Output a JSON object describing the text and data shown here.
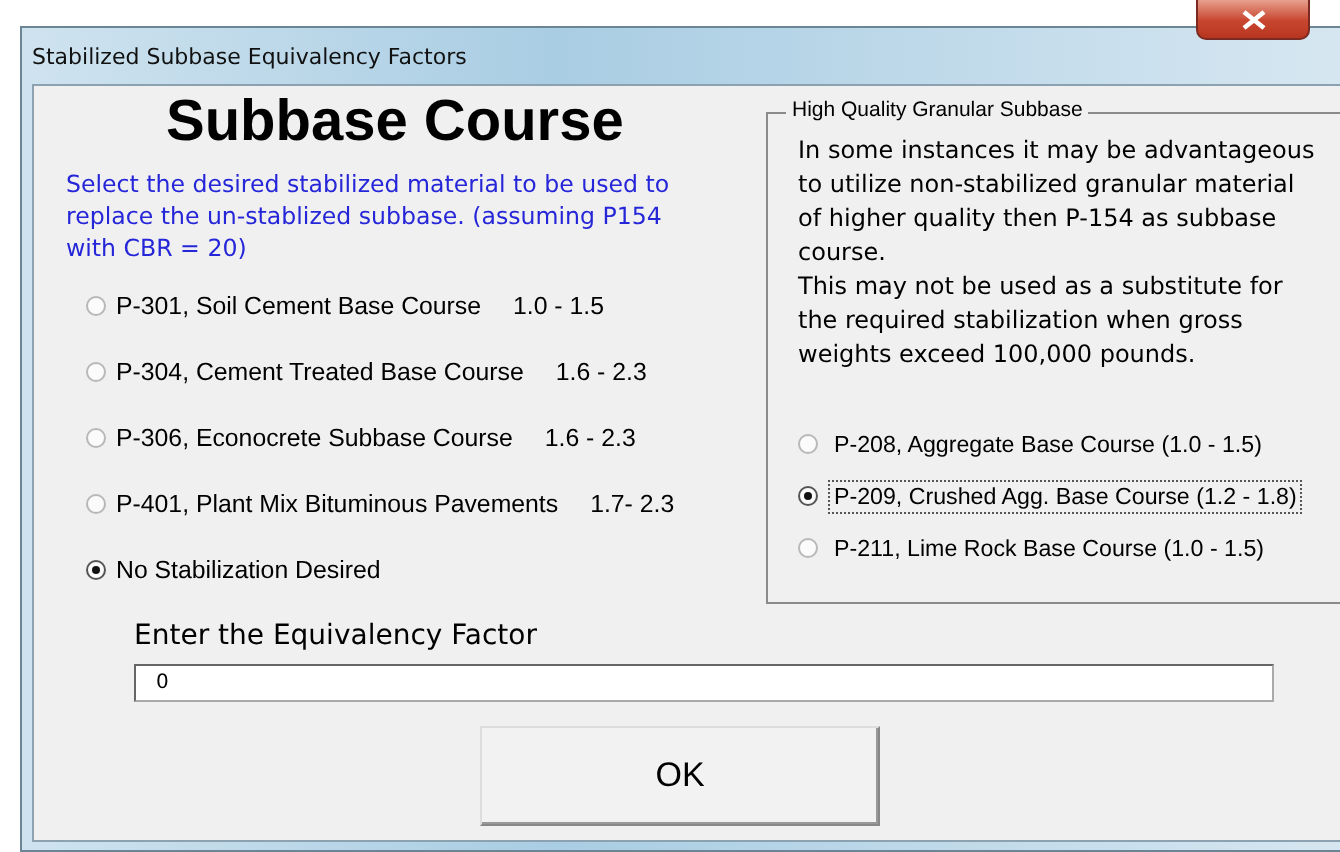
{
  "window": {
    "title": "Stabilized Subbase Equivalency Factors"
  },
  "heading": "Subbase Course",
  "instructions": "Select the desired stabilized material to be used to replace the un-stablized subbase. (assuming P154 with CBR = 20)",
  "stabilized_options": [
    {
      "label": "P-301, Soil Cement Base Course",
      "range": "1.0 - 1.5",
      "selected": false
    },
    {
      "label": "P-304, Cement Treated Base Course",
      "range": "1.6 - 2.3",
      "selected": false
    },
    {
      "label": "P-306, Econocrete Subbase Course",
      "range": "1.6 - 2.3",
      "selected": false
    },
    {
      "label": "P-401, Plant Mix Bituminous Pavements",
      "range": "1.7- 2.3",
      "selected": false
    },
    {
      "label": "No Stabilization Desired",
      "selected": true
    }
  ],
  "granular_group": {
    "title": "High Quality Granular Subbase",
    "paragraphs": [
      "In some instances it may be advantageous to utilize non-stabilized granular material of higher quality then P-154 as subbase course.",
      "This may not be used as a substitute for the required stabilization when gross weights exceed 100,000 pounds."
    ],
    "options": [
      {
        "label": "P-208, Aggregate Base Course  (1.0 - 1.5)",
        "selected": false,
        "focused": false
      },
      {
        "label": "P-209, Crushed Agg. Base Course (1.2 - 1.8)",
        "selected": true,
        "focused": true
      },
      {
        "label": "P-211, Lime Rock Base Course (1.0 - 1.5)",
        "selected": false,
        "focused": false
      }
    ]
  },
  "factor_field": {
    "label": "Enter the Equivalency Factor",
    "value": "0"
  },
  "buttons": [
    "OK"
  ]
}
